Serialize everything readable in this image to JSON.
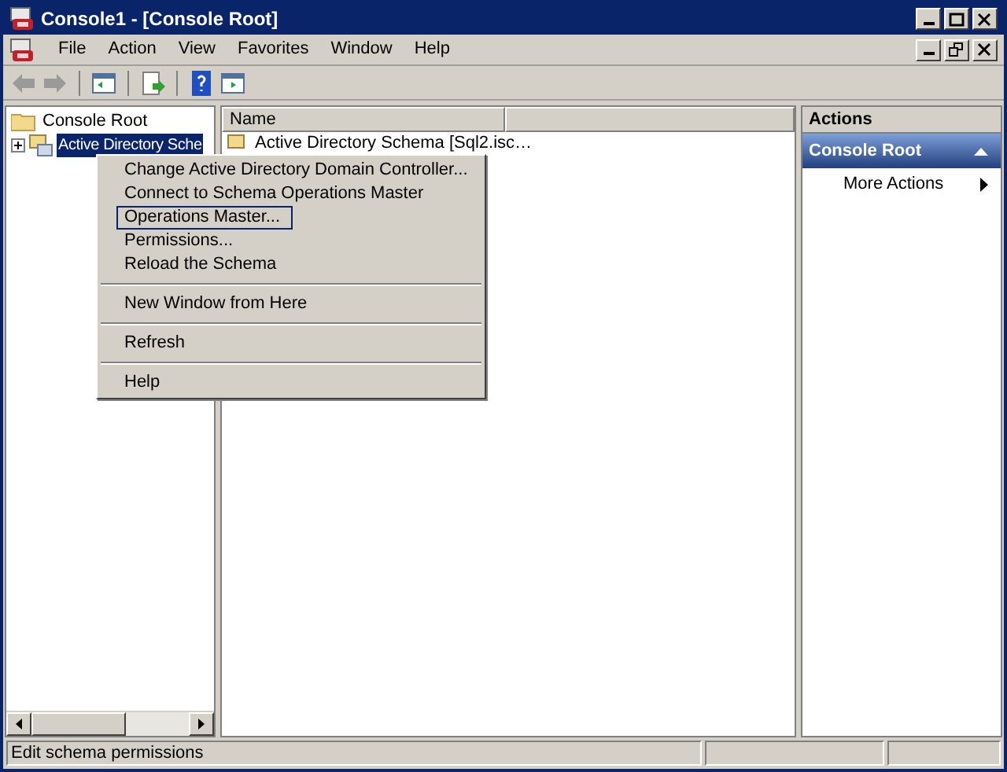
{
  "window": {
    "title": "Console1 - [Console Root]"
  },
  "menu_bar": [
    "File",
    "Action",
    "View",
    "Favorites",
    "Window",
    "Help"
  ],
  "tree": {
    "root": "Console Root",
    "children": [
      {
        "label": "Active Directory Sche",
        "selected": true
      }
    ]
  },
  "list": {
    "columns": [
      "Name"
    ],
    "rows": [
      "Active Directory Schema [Sql2.isc…"
    ]
  },
  "context_menu": {
    "groups": [
      [
        {
          "label": "Change Active Directory Domain Controller...",
          "selected": false
        },
        {
          "label": "Connect to Schema Operations Master",
          "selected": false
        },
        {
          "label": "Operations Master...",
          "selected": true
        },
        {
          "label": "Permissions...",
          "selected": false
        },
        {
          "label": "Reload the Schema",
          "selected": false
        }
      ],
      [
        {
          "label": "New Window from Here",
          "selected": false
        }
      ],
      [
        {
          "label": "Refresh",
          "selected": false
        }
      ],
      [
        {
          "label": "Help",
          "selected": false
        }
      ]
    ]
  },
  "actions": {
    "title": "Actions",
    "section": "Console Root",
    "items": [
      "More Actions"
    ]
  },
  "status_bar": [
    "Edit schema permissions"
  ]
}
